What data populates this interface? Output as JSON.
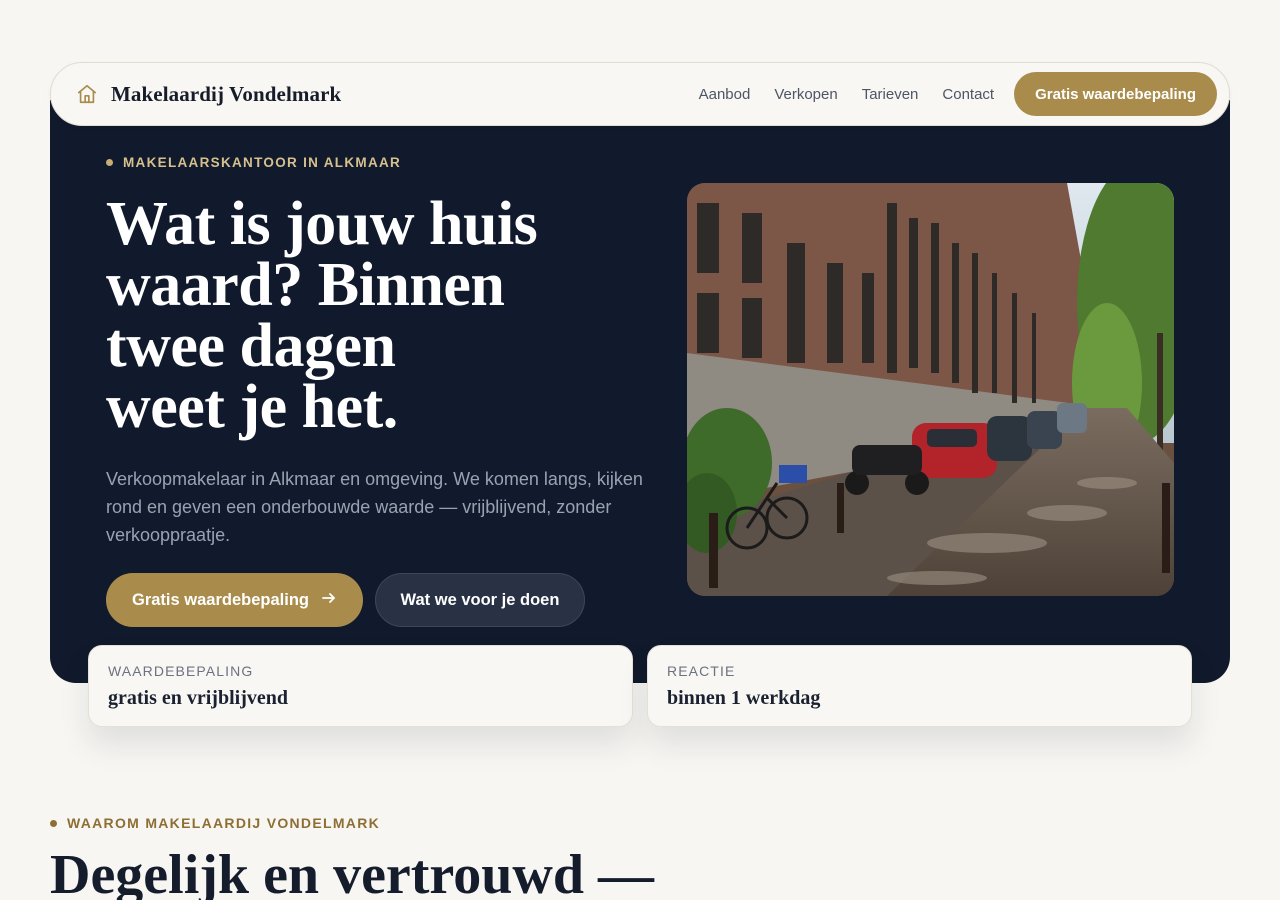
{
  "brand": {
    "name": "Makelaardij Vondelmark",
    "icon": "home-icon"
  },
  "nav": {
    "links": [
      "Aanbod",
      "Verkopen",
      "Tarieven",
      "Contact"
    ],
    "cta": "Gratis waardebepaling"
  },
  "hero": {
    "eyebrow": "MAKELAARSKANTOOR IN ALKMAAR",
    "headline_lines": [
      "Wat is jouw huis",
      "waard? Binnen",
      "twee dagen",
      "weet je het."
    ],
    "lede": "Verkoopmakelaar in Alkmaar en omgeving. We komen langs, kijken rond en geven een onderbouwde waarde — vrijblijvend, zonder verkooppraatje.",
    "primary_button": "Gratis waardebepaling",
    "primary_button_icon": "arrow-right-icon",
    "secondary_button": "Wat we voor je doen",
    "image": "canal-street-photo"
  },
  "cards": [
    {
      "label": "WAARDEBEPALING",
      "value": "gratis en vrijblijvend"
    },
    {
      "label": "REACTIE",
      "value": "binnen 1 werkdag"
    }
  ],
  "section": {
    "eyebrow": "WAAROM MAKELAARDIJ VONDELMARK",
    "title": "Degelijk en vertrouwd —"
  },
  "colors": {
    "accent": "#a98c4c",
    "dark": "#111a2c",
    "background": "#f7f6f3"
  }
}
